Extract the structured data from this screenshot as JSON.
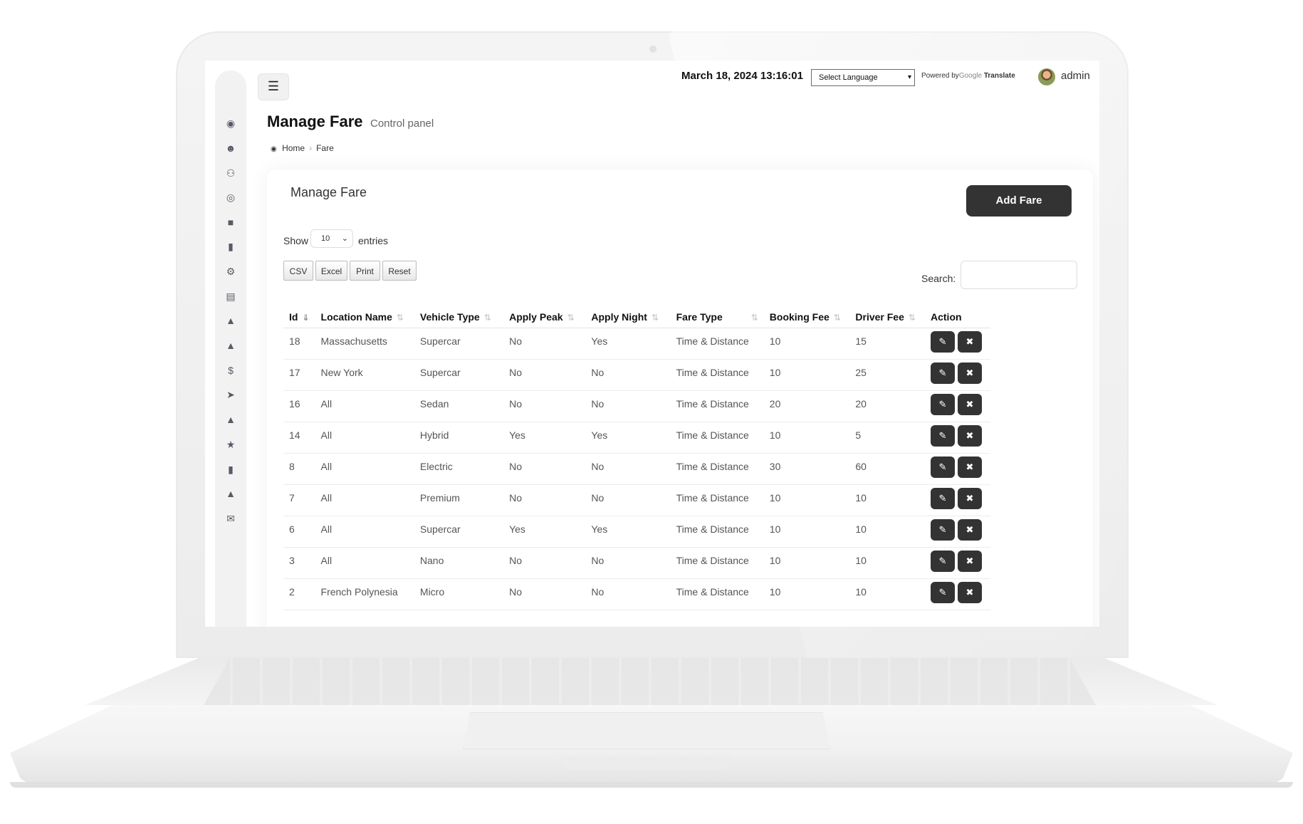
{
  "header": {
    "datetime": "March 18, 2024 13:16:01",
    "language_select": "Select Language",
    "powered_by": "Powered by",
    "google": "Google",
    "translate": "Translate",
    "user": "admin"
  },
  "page": {
    "title": "Manage Fare",
    "subtitle": "Control panel",
    "breadcrumb": {
      "home": "Home",
      "current": "Fare"
    }
  },
  "sidebar_icons": [
    "dashboard-icon",
    "user-add-icon",
    "users-icon",
    "life-ring-icon",
    "building-icon",
    "book-icon",
    "cogs-icon",
    "map-icon",
    "car-icon",
    "car-icon",
    "dollar-icon",
    "send-icon",
    "car-icon",
    "star-icon",
    "book-icon",
    "car-icon",
    "envelope-icon"
  ],
  "card": {
    "title": "Manage Fare",
    "add_button": "Add Fare",
    "show_label": "Show",
    "entries_value": "10",
    "entries_label": "entries",
    "export_buttons": [
      "CSV",
      "Excel",
      "Print",
      "Reset"
    ],
    "search_label": "Search:"
  },
  "table": {
    "columns": [
      "Id",
      "Location Name",
      "Vehicle Type",
      "Apply Peak",
      "Apply Night",
      "Fare Type",
      "Booking Fee",
      "Driver Fee",
      "Action"
    ],
    "rows": [
      [
        "18",
        "Massachusetts",
        "Supercar",
        "No",
        "Yes",
        "Time & Distance",
        "10",
        "15"
      ],
      [
        "17",
        "New York",
        "Supercar",
        "No",
        "No",
        "Time & Distance",
        "10",
        "25"
      ],
      [
        "16",
        "All",
        "Sedan",
        "No",
        "No",
        "Time & Distance",
        "20",
        "20"
      ],
      [
        "14",
        "All",
        "Hybrid",
        "Yes",
        "Yes",
        "Time & Distance",
        "10",
        "5"
      ],
      [
        "8",
        "All",
        "Electric",
        "No",
        "No",
        "Time & Distance",
        "30",
        "60"
      ],
      [
        "7",
        "All",
        "Premium",
        "No",
        "No",
        "Time & Distance",
        "10",
        "10"
      ],
      [
        "6",
        "All",
        "Supercar",
        "Yes",
        "Yes",
        "Time & Distance",
        "10",
        "10"
      ],
      [
        "3",
        "All",
        "Nano",
        "No",
        "No",
        "Time & Distance",
        "10",
        "10"
      ],
      [
        "2",
        "French Polynesia",
        "Micro",
        "No",
        "No",
        "Time & Distance",
        "10",
        "10"
      ]
    ]
  }
}
